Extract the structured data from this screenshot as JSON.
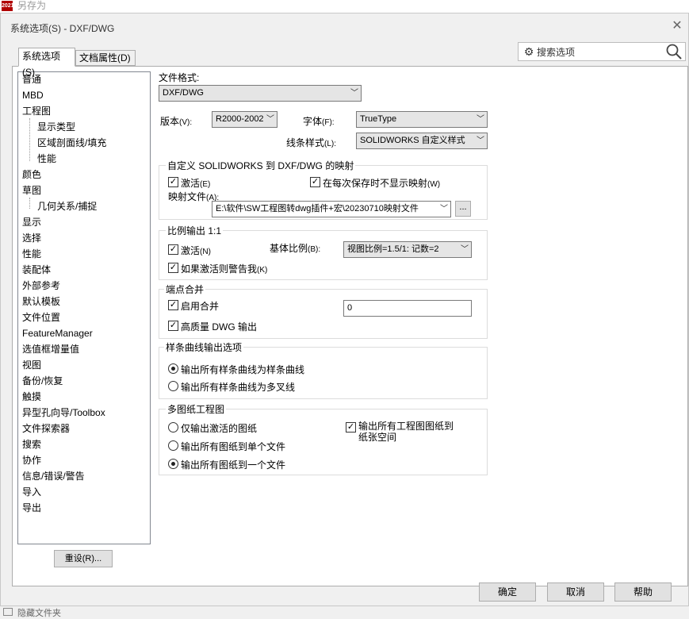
{
  "parent_window": {
    "title": "另存为",
    "logo_text": "2021"
  },
  "dialog": {
    "title": "系统选项(S) - DXF/DWG",
    "close_glyph": "✕"
  },
  "tabs": [
    {
      "label": "系统选项(S)",
      "active": true
    },
    {
      "label": "文档属性(D)",
      "active": false
    }
  ],
  "search": {
    "placeholder": "搜索选项"
  },
  "tree": {
    "items": [
      {
        "label": "普通",
        "level": 0
      },
      {
        "label": "MBD",
        "level": 0
      },
      {
        "label": "工程图",
        "level": 0
      },
      {
        "label": "显示类型",
        "level": 1
      },
      {
        "label": "区域剖面线/填充",
        "level": 1
      },
      {
        "label": "性能",
        "level": 1
      },
      {
        "label": "颜色",
        "level": 0
      },
      {
        "label": "草图",
        "level": 0
      },
      {
        "label": "几何关系/捕捉",
        "level": 1
      },
      {
        "label": "显示",
        "level": 0
      },
      {
        "label": "选择",
        "level": 0
      },
      {
        "label": "性能",
        "level": 0
      },
      {
        "label": "装配体",
        "level": 0
      },
      {
        "label": "外部参考",
        "level": 0
      },
      {
        "label": "默认模板",
        "level": 0
      },
      {
        "label": "文件位置",
        "level": 0
      },
      {
        "label": "FeatureManager",
        "level": 0
      },
      {
        "label": "选值框增量值",
        "level": 0
      },
      {
        "label": "视图",
        "level": 0
      },
      {
        "label": "备份/恢复",
        "level": 0
      },
      {
        "label": "触摸",
        "level": 0
      },
      {
        "label": "异型孔向导/Toolbox",
        "level": 0
      },
      {
        "label": "文件探索器",
        "level": 0
      },
      {
        "label": "搜索",
        "level": 0
      },
      {
        "label": "协作",
        "level": 0
      },
      {
        "label": "信息/错误/警告",
        "level": 0
      },
      {
        "label": "导入",
        "level": 0
      },
      {
        "label": "导出",
        "level": 0
      }
    ],
    "reset_label": "重设(R)..."
  },
  "file_format": {
    "label": "文件格式:",
    "value": "DXF/DWG"
  },
  "version": {
    "label": "版本",
    "shortcut": "(V):",
    "value": "R2000-2002"
  },
  "font": {
    "label": "字体",
    "shortcut": "(F):",
    "value": "TrueType"
  },
  "line_style": {
    "label": "线条样式",
    "shortcut": "(L):",
    "value": "SOLIDWORKS 自定义样式"
  },
  "mapping": {
    "title": "自定义 SOLIDWORKS 到 DXF/DWG 的映射",
    "activate": {
      "label": "激活",
      "shortcut": "(E)",
      "checked": true
    },
    "no_show": {
      "label": "在每次保存时不显示映射",
      "shortcut": "(W)",
      "checked": true
    },
    "file_label": "映射文件",
    "file_shortcut": "(A):",
    "file_value": "E:\\软件\\SW工程图转dwg插件+宏\\20230710映射文件",
    "browse_label": "..."
  },
  "scale": {
    "title": "比例输出 1:1",
    "activate": {
      "label": "激活",
      "shortcut": "(N)",
      "checked": true
    },
    "base_label": "基体比例",
    "base_shortcut": "(B):",
    "base_value": "视图比例=1.5/1: 记数=2",
    "warn": {
      "label": "如果激活则警告我",
      "shortcut": "(K)",
      "checked": true
    }
  },
  "merge": {
    "title": "端点合并",
    "enable": {
      "label": "启用合并",
      "checked": true
    },
    "value": "0",
    "hq": {
      "label": "高质量 DWG 输出",
      "checked": true
    }
  },
  "spline": {
    "title": "样条曲线输出选项",
    "options": [
      {
        "label": "输出所有样条曲线为样条曲线",
        "selected": true
      },
      {
        "label": "输出所有样条曲线为多叉线",
        "selected": false
      }
    ]
  },
  "multisheet": {
    "title": "多图纸工程图",
    "options": [
      {
        "label": "仅输出激活的图纸",
        "selected": false
      },
      {
        "label": "输出所有图纸到单个文件",
        "selected": false
      },
      {
        "label": "输出所有图纸到一个文件",
        "selected": true
      }
    ],
    "paper_space": {
      "label_line1": "输出所有工程图图纸到",
      "label_line2": "纸张空间",
      "checked": true
    }
  },
  "footer": {
    "ok": "确定",
    "cancel": "取消",
    "help": "帮助"
  },
  "bottom": {
    "hidden_folders": "隐藏文件夹"
  }
}
